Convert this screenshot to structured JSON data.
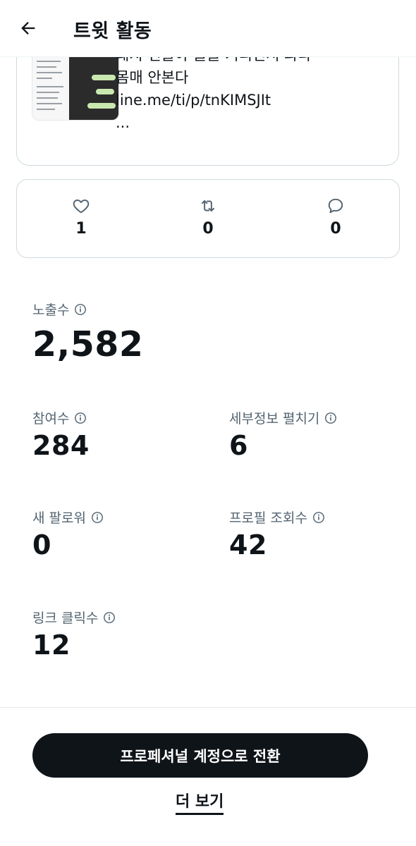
{
  "header": {
    "title": "트윗 활동",
    "back_icon": "arrow-left-icon"
  },
  "tweet": {
    "lines": [
      "돼지 년들아  꿀꿀 거리면서 와라",
      "몸매 안본다",
      "line.me/ti/p/tnKIMSJIt",
      "..."
    ]
  },
  "engagement": {
    "likes": "1",
    "retweets": "0",
    "replies": "0",
    "icons": [
      "heart-icon",
      "retweet-icon",
      "reply-icon"
    ]
  },
  "metrics": {
    "impressions": {
      "label": "노출수",
      "value": "2,582"
    },
    "engagements": {
      "label": "참여수",
      "value": "284"
    },
    "detail_expands": {
      "label": "세부정보 펼치기",
      "value": "6"
    },
    "new_followers": {
      "label": "새 팔로워",
      "value": "0"
    },
    "profile_visits": {
      "label": "프로필 조회수",
      "value": "42"
    },
    "link_clicks": {
      "label": "링크 클릭수",
      "value": "12"
    }
  },
  "actions": {
    "professional_button": "프로페셔널 계정으로 전환",
    "more_link": "더 보기"
  }
}
